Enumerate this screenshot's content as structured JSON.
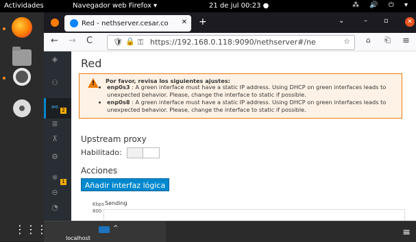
{
  "os_topbar": {
    "activities": "Actividades",
    "app_name": "Navegador web Firefox ▾",
    "clock": "21 de jul  00:23  ●",
    "tray": "⁂ 🔊 ⏻ ▾"
  },
  "dock": {
    "apps_grid_glyph": "⋮⋮⋮"
  },
  "browser": {
    "tab_title": "Red - nethserver.cesar.co",
    "tab_close": "✕",
    "new_tab": "+",
    "tab_list": "⌄",
    "minimize": "–",
    "maximize": "▫",
    "close": "✕",
    "nav_back": "←",
    "nav_forward": "→",
    "nav_reload": "C",
    "url": "https://192.168.0.118:9090/nethserver#/ne",
    "bookmark_star": "☆",
    "pocket": "⌂",
    "extensions": "⎗",
    "menu": "≡"
  },
  "sidebar": {
    "badge_1": "2",
    "badge_2": "1"
  },
  "page": {
    "title": "Red",
    "alert": {
      "heading": "Por favor, revisa los siguientes ajustes:",
      "items": [
        {
          "iface": "enp0s3",
          "msg": " : A green interface must have a static IP address. Using DHCP on green interfaces leads to unexpected behavior. Please, change the interface to static if possible."
        },
        {
          "iface": "enp0s8",
          "msg": " : A green interface must have a static IP address. Using DHCP on green interfaces leads to unexpected behavior. Please, change the interface to static if possible."
        }
      ]
    },
    "upstream_proxy": "Upstream proxy",
    "enabled_label": "Habilitado:",
    "actions_heading": "Acciones",
    "add_logical_interface": "Añadir interfaz lógica",
    "chart": {
      "unit": "Kbps",
      "series": "Sending",
      "tick_top": "800"
    }
  },
  "taskbar": {
    "host": "localhost",
    "caret": "^",
    "menu": "≡"
  }
}
